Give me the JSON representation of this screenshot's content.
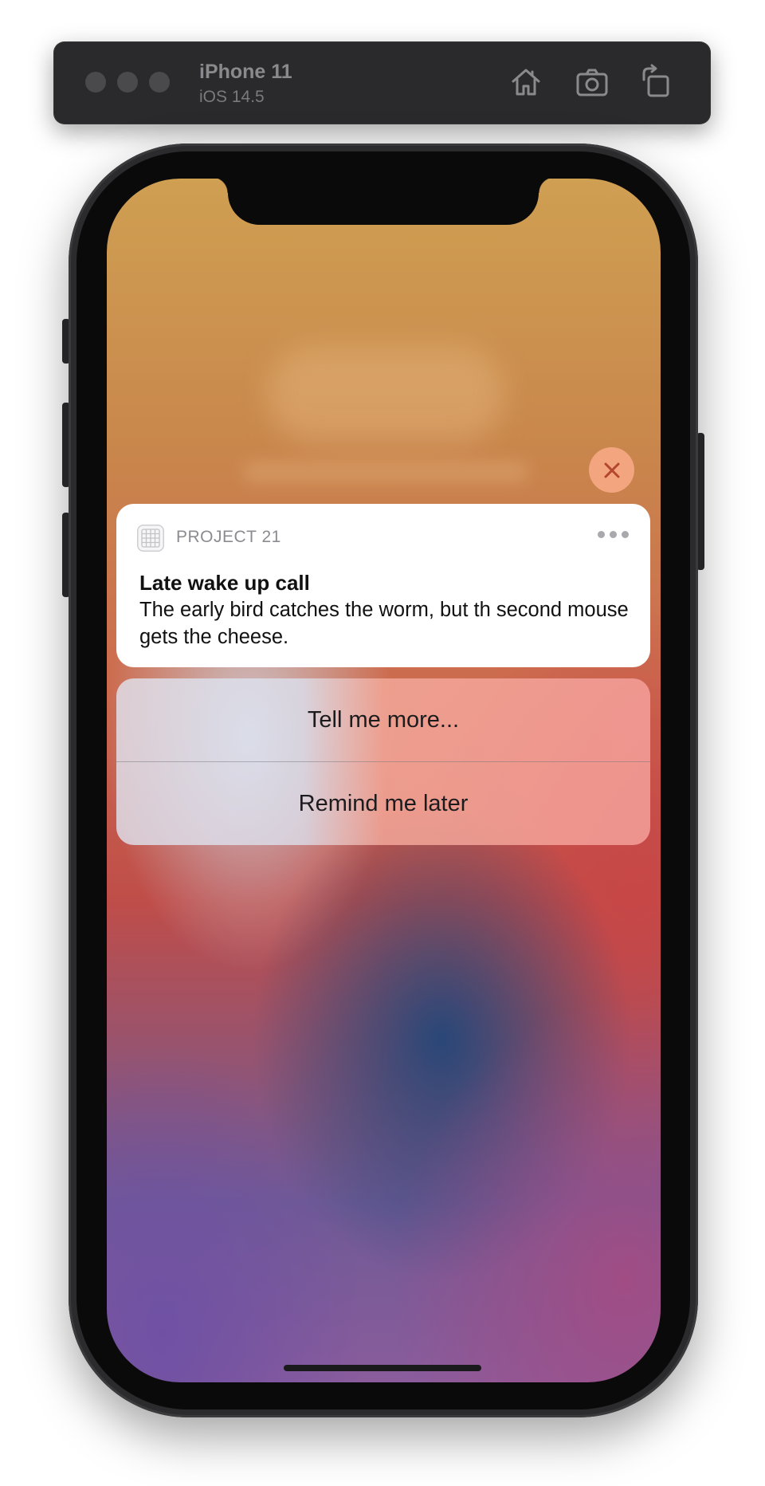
{
  "simulator": {
    "device_name": "iPhone 11",
    "os_version": "iOS 14.5",
    "toolbar_icons": [
      "home-icon",
      "screenshot-icon",
      "rotate-icon"
    ]
  },
  "notification": {
    "app_name": "PROJECT 21",
    "app_icon": "grid-app-icon",
    "title": "Late wake up call",
    "body": "The early bird catches the worm, but th second mouse gets the cheese.",
    "dismiss_icon": "close-icon",
    "options_icon": "more-icon",
    "actions": [
      {
        "label": "Tell me more..."
      },
      {
        "label": "Remind me later"
      }
    ]
  },
  "colors": {
    "toolbar": "#2a2a2c",
    "dismiss_button": "#f2a57f",
    "card": "#ffffff"
  }
}
